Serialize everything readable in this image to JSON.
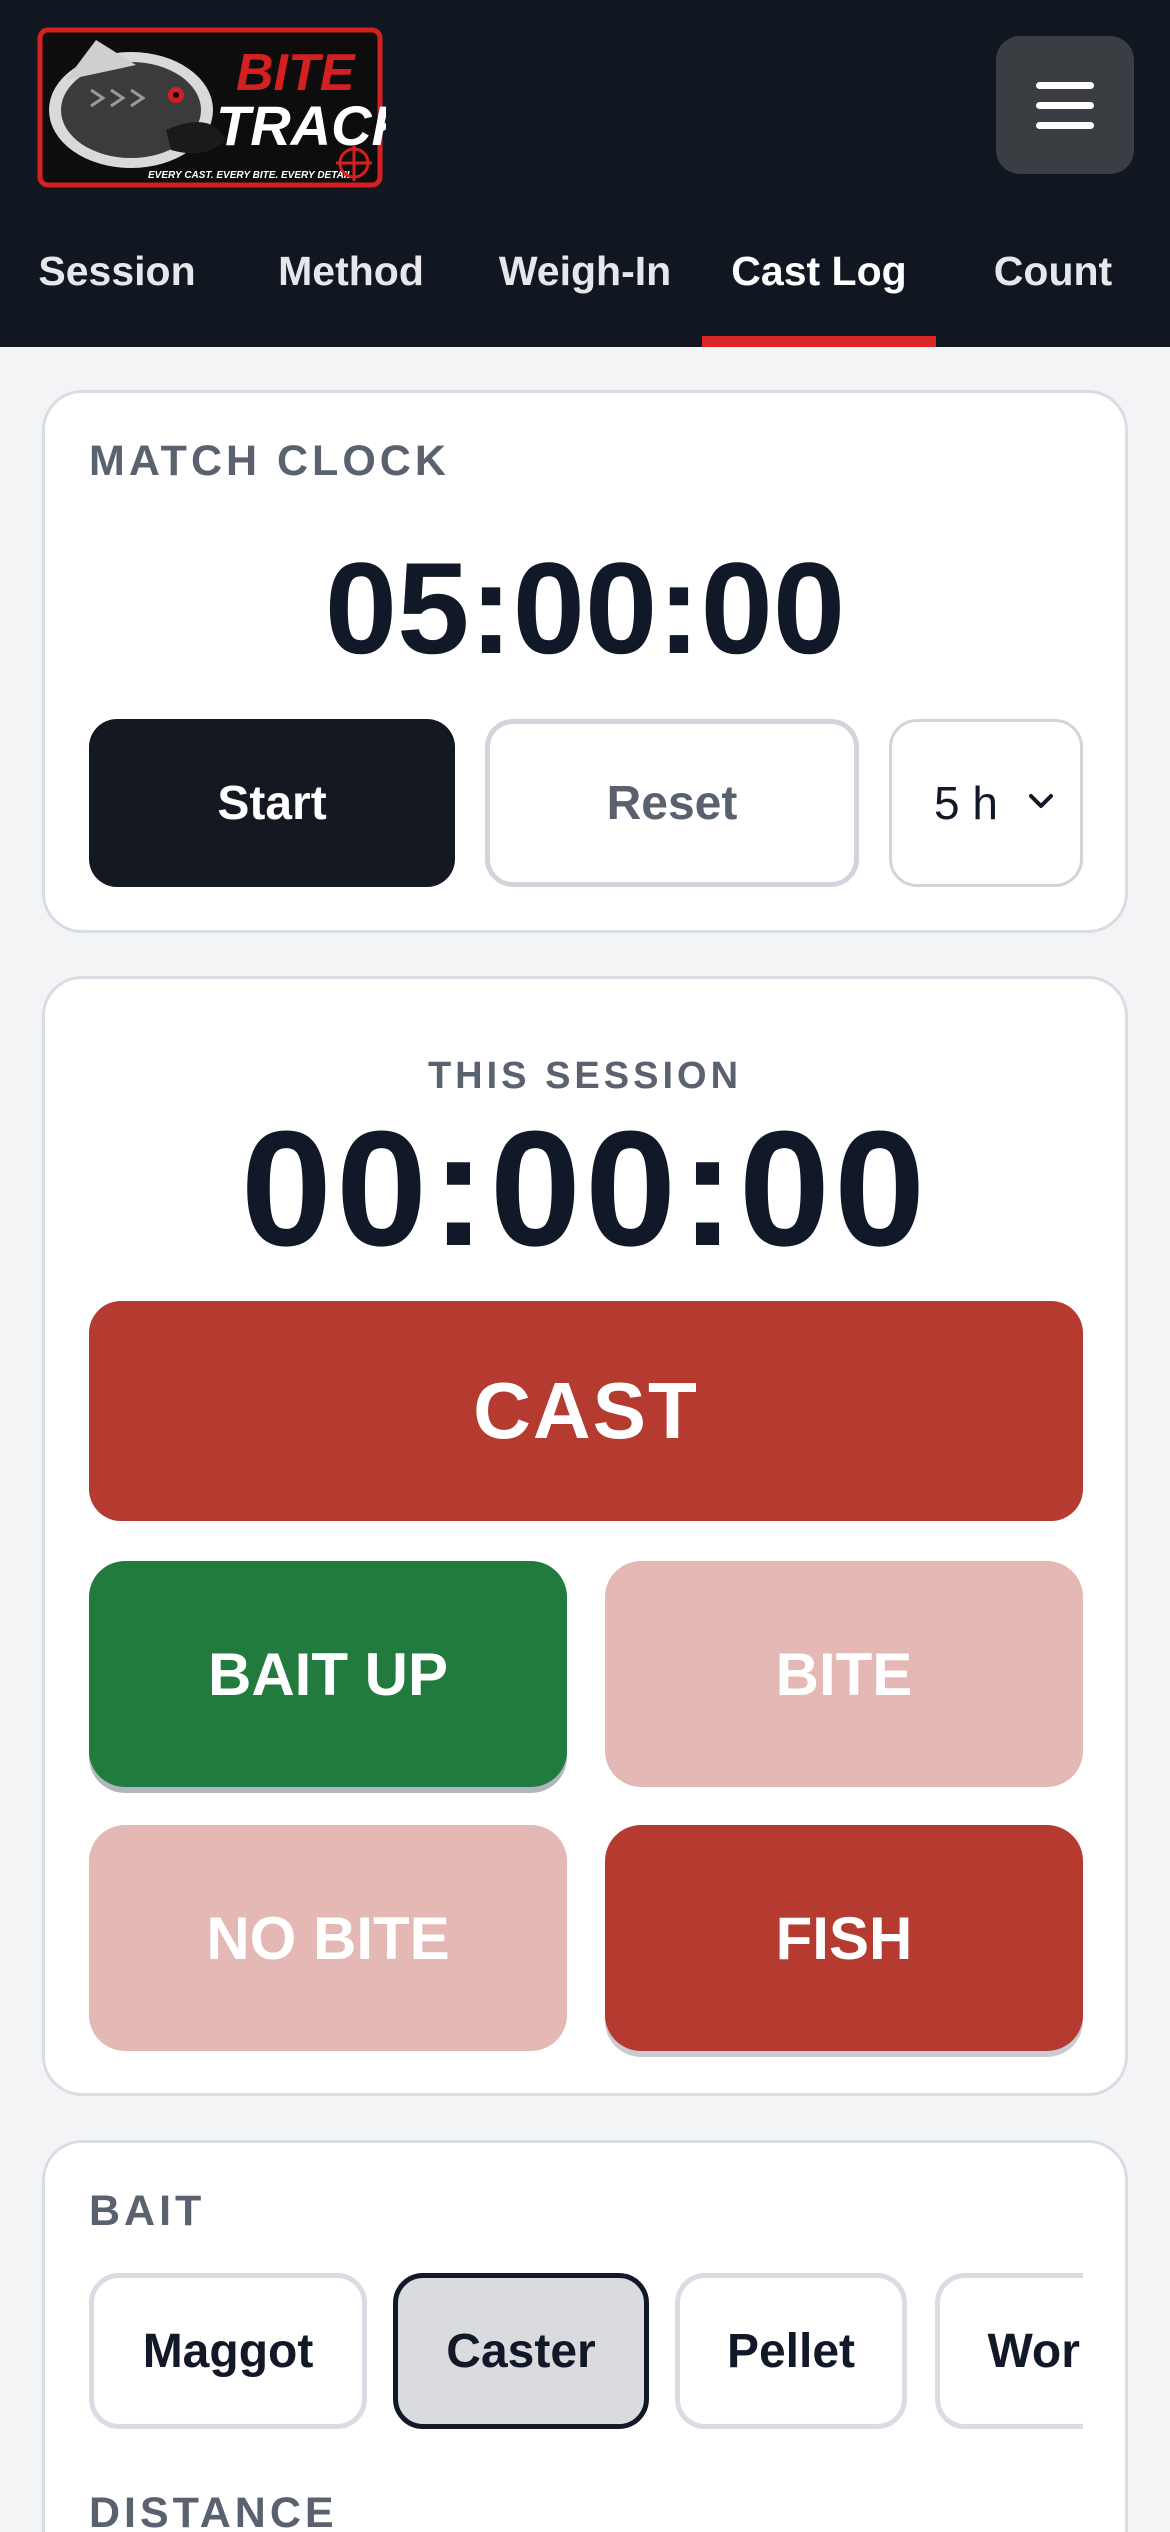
{
  "header": {
    "logo": {
      "name": "bite-track-logo",
      "text_line1": "BITE",
      "text_line2": "TRACK",
      "tagline": "EVERY CAST. EVERY BITE. EVERY DETAIL"
    },
    "menu_icon": "hamburger-menu-icon"
  },
  "tabs": [
    {
      "label": "Session",
      "active": false
    },
    {
      "label": "Method",
      "active": false
    },
    {
      "label": "Weigh-In",
      "active": false
    },
    {
      "label": "Cast Log",
      "active": true
    },
    {
      "label": "Count",
      "active": false
    }
  ],
  "match_clock": {
    "label": "MATCH CLOCK",
    "time": "05:00:00",
    "start_label": "Start",
    "reset_label": "Reset",
    "duration_selected": "5 h"
  },
  "session": {
    "label": "THIS SESSION",
    "time": "00:00:00",
    "cast_label": "CAST",
    "bait_up_label": "BAIT UP",
    "bite_label": "BITE",
    "no_bite_label": "NO BITE",
    "fish_label": "FISH"
  },
  "bait": {
    "label": "BAIT",
    "options": [
      "Maggot",
      "Caster",
      "Pellet",
      "Worm"
    ],
    "selected": "Caster"
  },
  "distance": {
    "label": "DISTANCE"
  },
  "colors": {
    "header_bg": "#111720",
    "accent_red": "#dc2626",
    "cast_red": "#b53a30",
    "bait_up_green": "#227b3e",
    "disabled_pink": "#e4b8b4"
  }
}
